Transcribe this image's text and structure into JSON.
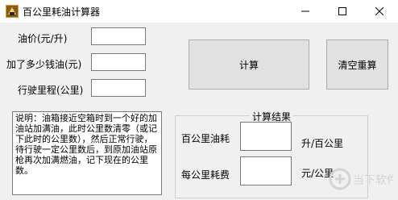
{
  "window": {
    "title": "百公里耗油计算器",
    "controls": {
      "minimize": "—",
      "maximize": "☐",
      "close": "✕"
    }
  },
  "form": {
    "oil_price_label": "油价(元/升)",
    "oil_price_value": "",
    "fuel_added_label": "加了多少钱油(元)",
    "fuel_added_value": "",
    "mileage_label": "行驶里程(公里)",
    "mileage_value": ""
  },
  "buttons": {
    "calculate": "计算",
    "clear": "清空重算"
  },
  "memo_text": "说明：油箱接近空箱时到一个好的加油站加满油，此时公里数清零（或记下此时的公里数），然后正常行驶，待行驶一定公里数后，到原加油站原枪再次加满燃油，记下现在的公里数。",
  "results": {
    "group_title": "计算结果",
    "per100_label": "百公里油耗",
    "per100_value": "",
    "per100_unit": "升/百公里",
    "perkm_label": "每公里耗费",
    "perkm_value": "",
    "perkm_unit": "元/公里"
  },
  "watermark": {
    "text": "当下软件园",
    "brand_color": "#d0d0d0"
  }
}
